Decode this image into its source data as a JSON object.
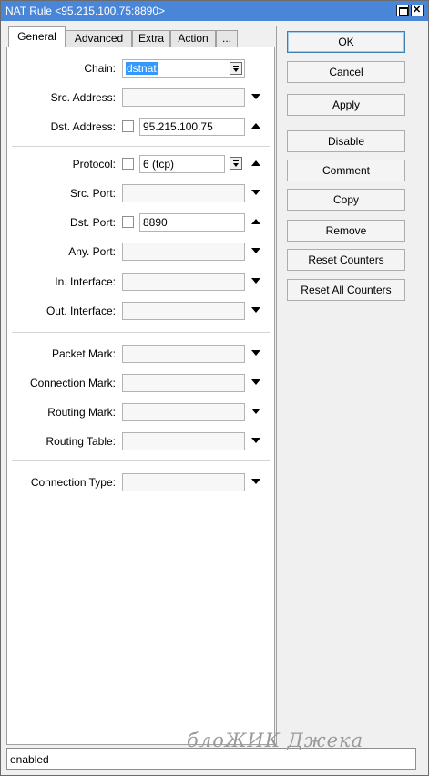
{
  "window": {
    "title": "NAT Rule <95.215.100.75:8890>",
    "colors": {
      "titlebar": "#4a86d8",
      "selection": "#3399ff"
    }
  },
  "tabs": [
    "General",
    "Advanced",
    "Extra",
    "Action",
    "..."
  ],
  "active_tab": "General",
  "form": {
    "chain": {
      "label": "Chain:",
      "value": "dstnat"
    },
    "src_address": {
      "label": "Src. Address:",
      "value": ""
    },
    "dst_address": {
      "label": "Dst. Address:",
      "value": "95.215.100.75"
    },
    "protocol": {
      "label": "Protocol:",
      "value": "6 (tcp)"
    },
    "src_port": {
      "label": "Src. Port:",
      "value": ""
    },
    "dst_port": {
      "label": "Dst. Port:",
      "value": "8890"
    },
    "any_port": {
      "label": "Any. Port:",
      "value": ""
    },
    "in_interface": {
      "label": "In. Interface:",
      "value": ""
    },
    "out_interface": {
      "label": "Out. Interface:",
      "value": ""
    },
    "packet_mark": {
      "label": "Packet Mark:",
      "value": ""
    },
    "connection_mark": {
      "label": "Connection Mark:",
      "value": ""
    },
    "routing_mark": {
      "label": "Routing Mark:",
      "value": ""
    },
    "routing_table": {
      "label": "Routing Table:",
      "value": ""
    },
    "connection_type": {
      "label": "Connection Type:",
      "value": ""
    }
  },
  "buttons": {
    "ok": "OK",
    "cancel": "Cancel",
    "apply": "Apply",
    "disable": "Disable",
    "comment": "Comment",
    "copy": "Copy",
    "remove": "Remove",
    "reset_counters": "Reset Counters",
    "reset_all_counters": "Reset All Counters"
  },
  "status": "enabled",
  "watermark": "блоЖИК Джека"
}
